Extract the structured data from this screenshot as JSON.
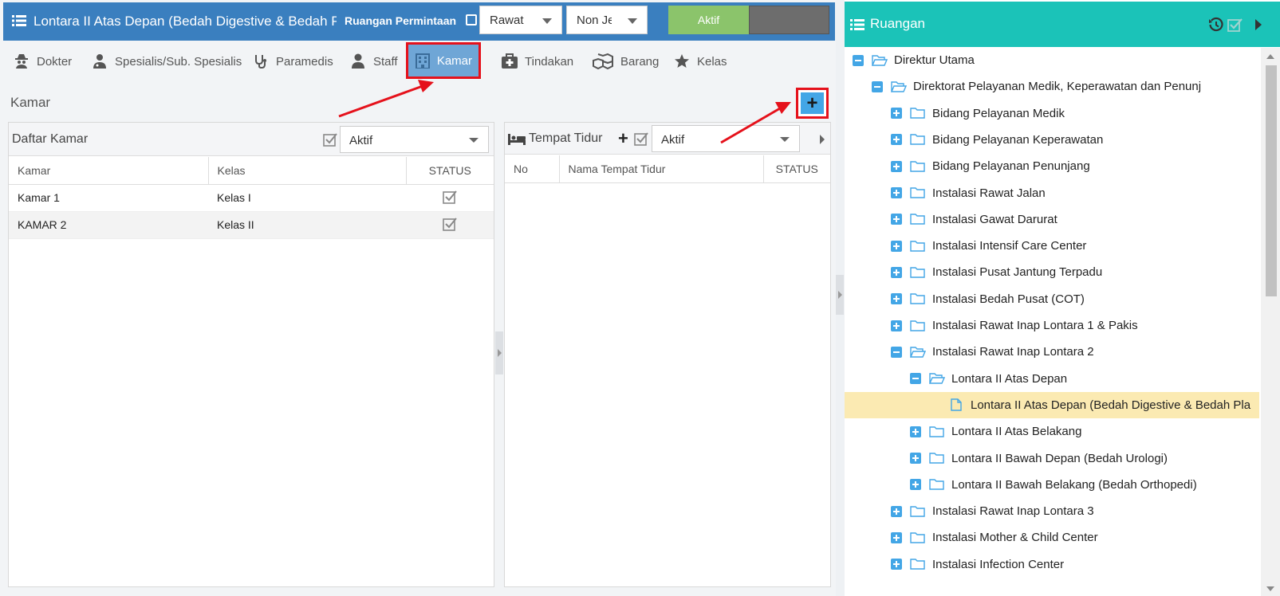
{
  "header": {
    "title": "Lontara II Atas Depan (Bedah Digestive & Bedah Pla",
    "ruangan_permintaan_label": "Ruangan Permintaan",
    "select_rawat": "Rawat",
    "select_non": "Non Je",
    "aktif_label": "Aktif"
  },
  "tabs": [
    {
      "label": "Dokter",
      "icon": "spy-icon"
    },
    {
      "label": "Spesialis/Sub. Spesialis",
      "icon": "doctor-icon"
    },
    {
      "label": "Paramedis",
      "icon": "stethoscope-icon"
    },
    {
      "label": "Staff",
      "icon": "user-icon"
    },
    {
      "label": "Kamar",
      "icon": "building-icon",
      "active": true
    },
    {
      "label": "Tindakan",
      "icon": "medkit-icon"
    },
    {
      "label": "Barang",
      "icon": "cubes-icon"
    },
    {
      "label": "Kelas",
      "icon": "star-icon"
    }
  ],
  "section_label": "Kamar",
  "daftar_kamar": {
    "title": "Daftar Kamar",
    "filter": "Aktif",
    "columns": [
      "Kamar",
      "Kelas",
      "STATUS"
    ],
    "rows": [
      {
        "kamar": "Kamar 1",
        "kelas": "Kelas I",
        "status": true
      },
      {
        "kamar": "KAMAR 2",
        "kelas": "Kelas II",
        "status": true
      }
    ]
  },
  "tempat_tidur": {
    "title": "Tempat Tidur",
    "filter": "Aktif",
    "columns": [
      "No",
      "Nama Tempat Tidur",
      "STATUS"
    ]
  },
  "ruangan": {
    "title": "Ruangan",
    "tree": [
      {
        "label": "Direktur Utama",
        "level": 0,
        "toggle": "minus",
        "open": true
      },
      {
        "label": "Direktorat Pelayanan Medik, Keperawatan dan Penunj",
        "level": 1,
        "toggle": "minus",
        "open": true
      },
      {
        "label": "Bidang Pelayanan Medik",
        "level": 2,
        "toggle": "plus"
      },
      {
        "label": "Bidang Pelayanan Keperawatan",
        "level": 2,
        "toggle": "plus"
      },
      {
        "label": "Bidang Pelayanan Penunjang",
        "level": 2,
        "toggle": "plus"
      },
      {
        "label": "Instalasi Rawat Jalan",
        "level": 2,
        "toggle": "plus"
      },
      {
        "label": "Instalasi Gawat Darurat",
        "level": 2,
        "toggle": "plus"
      },
      {
        "label": "Instalasi Intensif Care Center",
        "level": 2,
        "toggle": "plus"
      },
      {
        "label": "Instalasi Pusat Jantung Terpadu",
        "level": 2,
        "toggle": "plus"
      },
      {
        "label": "Instalasi Bedah Pusat (COT)",
        "level": 2,
        "toggle": "plus"
      },
      {
        "label": "Instalasi Rawat Inap Lontara 1 & Pakis",
        "level": 2,
        "toggle": "plus"
      },
      {
        "label": "Instalasi Rawat Inap Lontara 2",
        "level": 2,
        "toggle": "minus",
        "open": true
      },
      {
        "label": "Lontara II Atas Depan",
        "level": 3,
        "toggle": "minus",
        "open": true
      },
      {
        "label": "Lontara II Atas Depan (Bedah Digestive & Bedah Pla",
        "level": 4,
        "toggle": "none",
        "selected": true
      },
      {
        "label": "Lontara II Atas Belakang",
        "level": 3,
        "toggle": "plus"
      },
      {
        "label": "Lontara II Bawah Depan (Bedah Urologi)",
        "level": 3,
        "toggle": "plus"
      },
      {
        "label": "Lontara II Bawah Belakang (Bedah Orthopedi)",
        "level": 3,
        "toggle": "plus"
      },
      {
        "label": "Instalasi Rawat Inap Lontara 3",
        "level": 2,
        "toggle": "plus"
      },
      {
        "label": "Instalasi Mother & Child Center",
        "level": 2,
        "toggle": "plus"
      },
      {
        "label": "Instalasi Infection Center",
        "level": 2,
        "toggle": "plus"
      }
    ]
  },
  "colors": {
    "header_blue": "#3a7fbf",
    "teal": "#1bc3b8",
    "accent_blue": "#43a6e6",
    "active_green": "#8bc46b",
    "highlight_red": "#e5111b",
    "selected_row": "#fbeab2"
  }
}
